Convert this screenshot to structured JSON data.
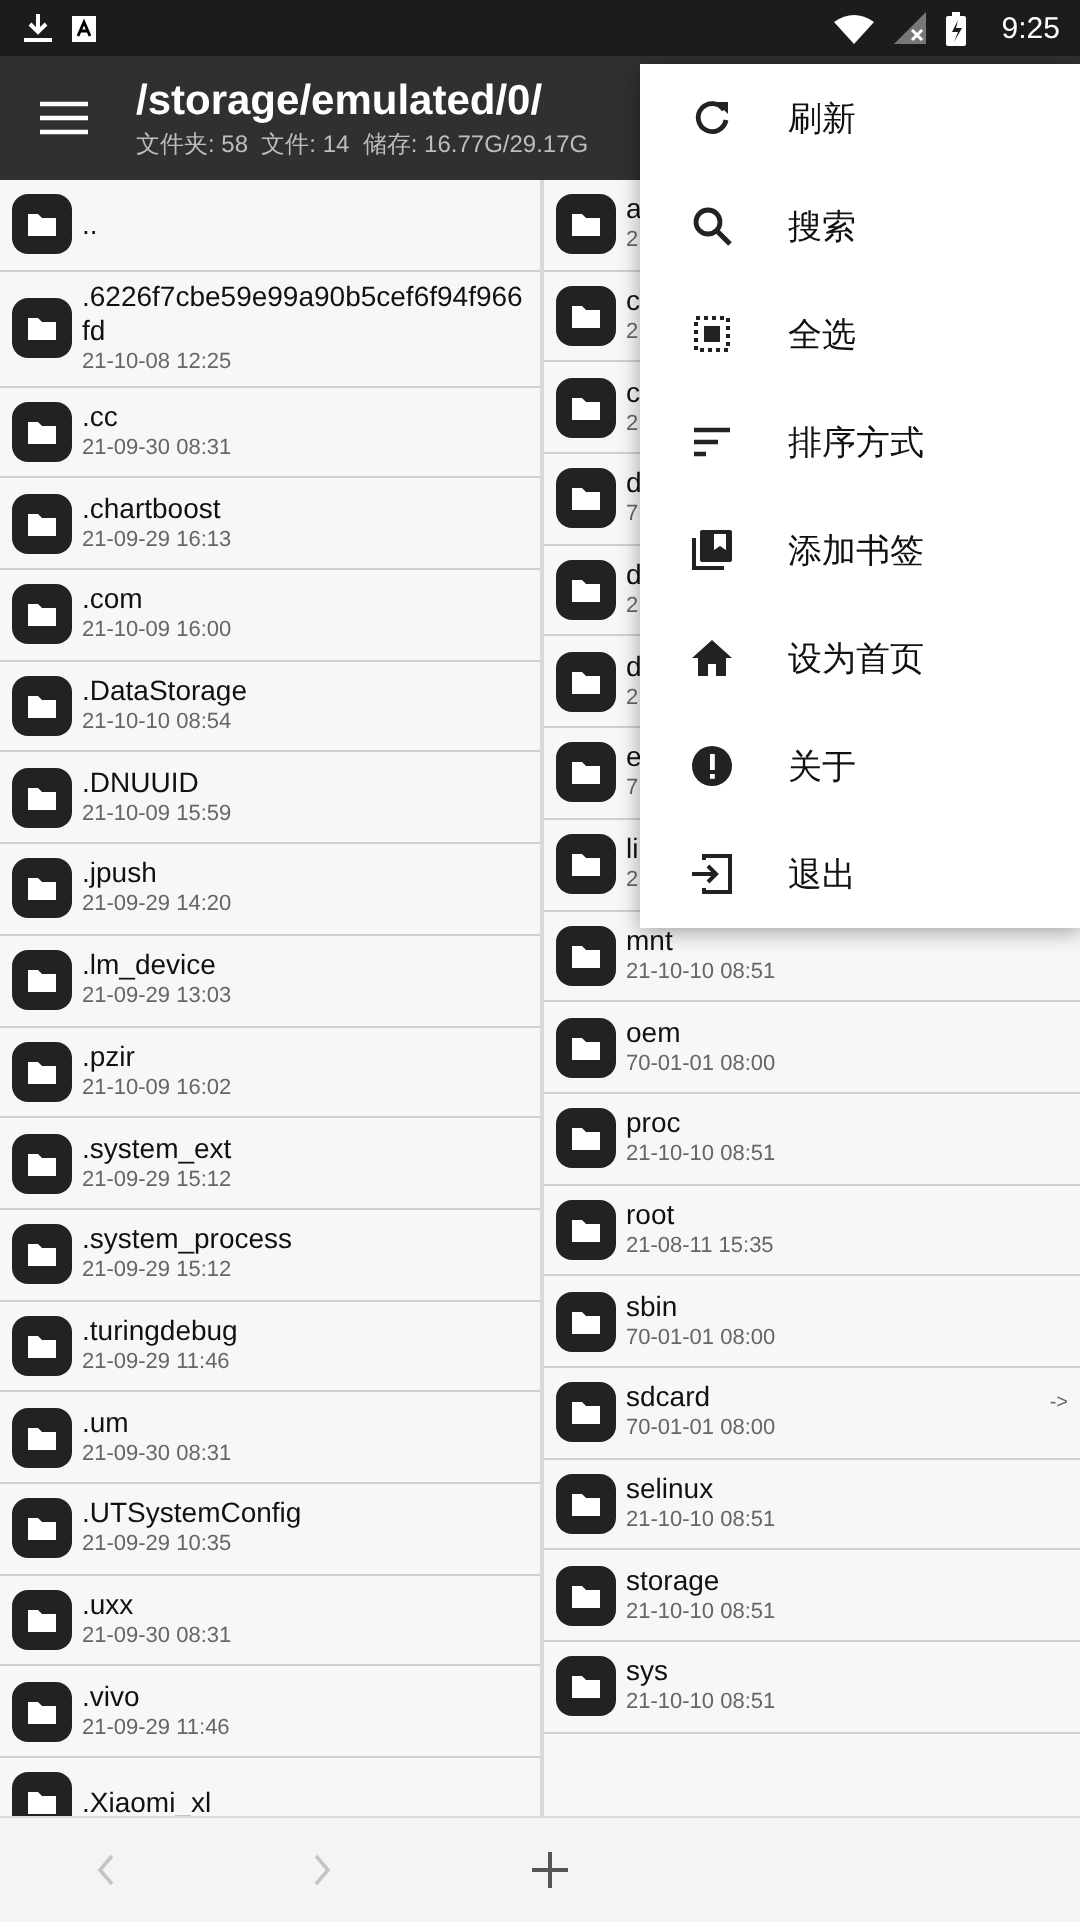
{
  "status_bar": {
    "time": "9:25"
  },
  "header": {
    "path": "/storage/emulated/0/",
    "summary": "文件夹: 58  文件: 14  储存: 16.77G/29.17G"
  },
  "left_list": [
    {
      "name": ".."
    },
    {
      "name": ".6226f7cbe59e99a90b5cef6f94f966fd",
      "date": "21-10-08 12:25"
    },
    {
      "name": ".cc",
      "date": "21-09-30 08:31"
    },
    {
      "name": ".chartboost",
      "date": "21-09-29 16:13"
    },
    {
      "name": ".com",
      "date": "21-10-09 16:00"
    },
    {
      "name": ".DataStorage",
      "date": "21-10-10 08:54"
    },
    {
      "name": ".DNUUID",
      "date": "21-10-09 15:59"
    },
    {
      "name": ".jpush",
      "date": "21-09-29 14:20"
    },
    {
      "name": ".lm_device",
      "date": "21-09-29 13:03"
    },
    {
      "name": ".pzir",
      "date": "21-10-09 16:02"
    },
    {
      "name": ".system_ext",
      "date": "21-09-29 15:12"
    },
    {
      "name": ".system_process",
      "date": "21-09-29 15:12"
    },
    {
      "name": ".turingdebug",
      "date": "21-09-29 11:46"
    },
    {
      "name": ".um",
      "date": "21-09-30 08:31"
    },
    {
      "name": ".UTSystemConfig",
      "date": "21-09-29 10:35"
    },
    {
      "name": ".uxx",
      "date": "21-09-30 08:31"
    },
    {
      "name": ".vivo",
      "date": "21-09-29 11:46"
    },
    {
      "name": ".Xiaomi_xl"
    }
  ],
  "right_list": [
    {
      "name": "a",
      "date": "2"
    },
    {
      "name": "c",
      "date": "2"
    },
    {
      "name": "c",
      "date": "2"
    },
    {
      "name": "d",
      "date": "7"
    },
    {
      "name": "d",
      "date": "2"
    },
    {
      "name": "d",
      "date": "2"
    },
    {
      "name": "e",
      "date": "7"
    },
    {
      "name": "li",
      "date": "2"
    },
    {
      "name": "mnt",
      "date": "21-10-10 08:51"
    },
    {
      "name": "oem",
      "date": "70-01-01 08:00"
    },
    {
      "name": "proc",
      "date": "21-10-10 08:51"
    },
    {
      "name": "root",
      "date": "21-08-11 15:35"
    },
    {
      "name": "sbin",
      "date": "70-01-01 08:00"
    },
    {
      "name": "sdcard",
      "date": "70-01-01 08:00",
      "link_mark": "->"
    },
    {
      "name": "selinux",
      "date": "21-10-10 08:51"
    },
    {
      "name": "storage",
      "date": "21-10-10 08:51"
    },
    {
      "name": "sys",
      "date": "21-10-10 08:51"
    }
  ],
  "menu": [
    {
      "kind": "refresh",
      "label": "刷新"
    },
    {
      "kind": "search",
      "label": "搜索"
    },
    {
      "kind": "select_all",
      "label": "全选"
    },
    {
      "kind": "sort",
      "label": "排序方式"
    },
    {
      "kind": "bookmark",
      "label": "添加书签"
    },
    {
      "kind": "home",
      "label": "设为首页"
    },
    {
      "kind": "about",
      "label": "关于"
    },
    {
      "kind": "exit",
      "label": "退出"
    }
  ],
  "bottom_bar": {
    "back_enabled": false,
    "forward_enabled": false
  }
}
